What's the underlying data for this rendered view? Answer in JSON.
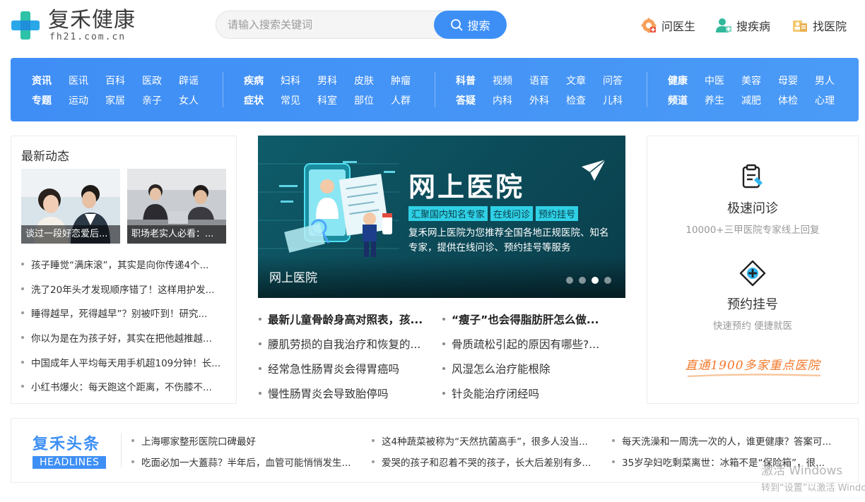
{
  "brand": {
    "name": "复禾健康",
    "domain": "fh21.com.cn"
  },
  "search": {
    "placeholder": "请输入搜索关键词",
    "button": "搜索"
  },
  "quick_links": [
    {
      "label": "问医生",
      "icon": "doctor-gear-icon"
    },
    {
      "label": "搜疾病",
      "icon": "person-plus-icon"
    },
    {
      "label": "找医院",
      "icon": "hospital-badge-icon"
    }
  ],
  "nav": {
    "groups": [
      {
        "rows": [
          [
            "资讯",
            "医讯",
            "百科",
            "医政",
            "辟谣"
          ],
          [
            "专题",
            "运动",
            "家居",
            "亲子",
            "女人"
          ]
        ]
      },
      {
        "rows": [
          [
            "疾病",
            "妇科",
            "男科",
            "皮肤",
            "肿瘤"
          ],
          [
            "症状",
            "常见",
            "科室",
            "部位",
            "人群"
          ]
        ]
      },
      {
        "rows": [
          [
            "科普",
            "视频",
            "语音",
            "文章",
            "问答"
          ],
          [
            "答疑",
            "内科",
            "外科",
            "检查",
            "儿科"
          ]
        ]
      },
      {
        "rows": [
          [
            "健康",
            "中医",
            "美容",
            "母婴",
            "男人"
          ],
          [
            "频道",
            "养生",
            "减肥",
            "体检",
            "心理"
          ]
        ]
      }
    ]
  },
  "latest": {
    "title": "最新动态",
    "thumbs": [
      {
        "caption": "谈过一段好恋爱后..."
      },
      {
        "caption": "职场老实人必看：..."
      }
    ],
    "items": [
      "孩子睡觉“满床滚”，其实是向你传递4个...",
      "洗了20年头才发现顺序错了！这样用护发...",
      "睡得越早，死得越早”？别被吓到！研究...",
      "你以为是在为孩子好，其实在把他越推越...",
      "中国成年人平均每天用手机超109分钟！长...",
      "小红书爆火：每天跑这个距离，不伤膝不..."
    ]
  },
  "banner": {
    "title": "网上医院",
    "tags": [
      "汇聚国内知名专家",
      "在线问诊",
      "预约挂号"
    ],
    "description": "复禾网上医院为您推荐全国各地正规医院、知名专家，提供在线问诊、预约挂号等服务",
    "caption": "网上医院",
    "slides": 4,
    "active_slide": 3
  },
  "center_news": [
    {
      "left": "最新儿童骨龄身高对照表，孩...",
      "right": "“瘦子”也会得脂肪肝怎么做...",
      "bold": true
    },
    {
      "left": "腰肌劳损的自我治疗和恢复的...",
      "right": "骨质疏松引起的原因有哪些?...",
      "bold": false
    },
    {
      "left": "经常急性肠胃炎会得胃癌吗",
      "right": "风湿怎么治疗能根除",
      "bold": false
    },
    {
      "left": "慢性肠胃炎会导致胎停吗",
      "right": "针灸能治疗闭经吗",
      "bold": false
    }
  ],
  "services": [
    {
      "title": "极速问诊",
      "subtitle": "10000+三甲医院专家线上回复",
      "icon": "clipboard-icon"
    },
    {
      "title": "预约挂号",
      "subtitle": "快速预约   便捷就医",
      "icon": "medical-cross-icon"
    }
  ],
  "slogan": "直通1900多家重点医院",
  "headlines": {
    "title": "复禾头条",
    "subtitle": "HEADLINES",
    "rows": [
      [
        "上海哪家整形医院口碑最好",
        "这4种蔬菜被称为“天然抗菌高手”，很多人没当...",
        "每天洗澡和一周洗一次的人，谁更健康？答案可..."
      ],
      [
        "吃面必加一大蓋蒜？半年后，血管可能悄悄发生...",
        "爱哭的孩子和忍着不哭的孩子，长大后差别有多...",
        "35岁孕妇吃剩菜离世：冰箱不是“保险箱”，很..."
      ]
    ]
  },
  "watermark": {
    "line1": "激活 Windows",
    "line2": "转到“设置”以激活 Windows。"
  },
  "colors": {
    "accent": "#3d8ff5",
    "nav_bg": "#4493f6",
    "banner_bg": "#0c4a58",
    "tag_bg": "#2fd0e5",
    "slogan": "#f2792b"
  }
}
